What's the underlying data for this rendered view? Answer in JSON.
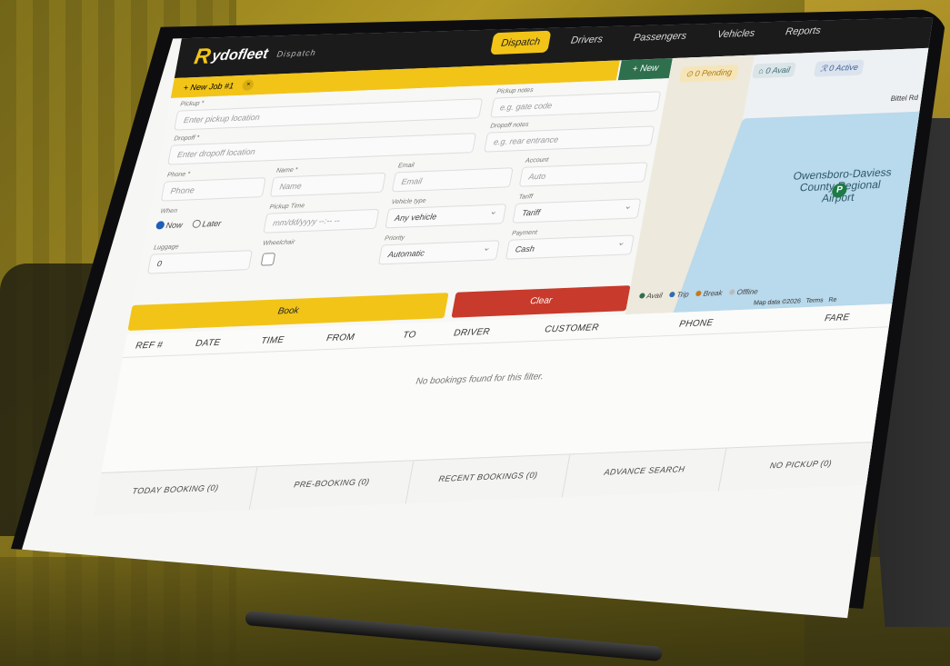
{
  "app": {
    "logo_mark": "R",
    "logo_text": "ydofleet",
    "logo_sub": "Dispatch"
  },
  "nav": [
    {
      "label": "Dispatch",
      "active": true
    },
    {
      "label": "Drivers",
      "active": false
    },
    {
      "label": "Passengers",
      "active": false
    },
    {
      "label": "Vehicles",
      "active": false
    },
    {
      "label": "Reports",
      "active": false
    }
  ],
  "job_tab": {
    "label": "+ New Job #1",
    "close": "×",
    "new_button": "+ New"
  },
  "form": {
    "pickup": {
      "label": "Pickup *",
      "placeholder": "Enter pickup location"
    },
    "pickup_notes": {
      "label": "Pickup notes",
      "placeholder": "e.g. gate code"
    },
    "dropoff": {
      "label": "Dropoff *",
      "placeholder": "Enter dropoff location"
    },
    "dropoff_notes": {
      "label": "Dropoff notes",
      "placeholder": "e.g. rear entrance"
    },
    "phone": {
      "label": "Phone *",
      "placeholder": "Phone"
    },
    "name": {
      "label": "Name *",
      "placeholder": "Name"
    },
    "email": {
      "label": "Email",
      "placeholder": "Email"
    },
    "account": {
      "label": "Account",
      "placeholder": "Auto"
    },
    "when": {
      "label": "When",
      "now": "Now",
      "later": "Later",
      "selected": "Now"
    },
    "pickup_time": {
      "label": "Pickup Time",
      "placeholder": "mm/dd/yyyy --:-- --"
    },
    "vehicle_type": {
      "label": "Vehicle type",
      "value": "Any vehicle"
    },
    "tariff": {
      "label": "Tariff",
      "value": "Tariff"
    },
    "luggage": {
      "label": "Luggage",
      "value": "0"
    },
    "wheelchair": {
      "label": "Wheelchair"
    },
    "priority": {
      "label": "Priority",
      "value": "Automatic"
    },
    "payment": {
      "label": "Payment",
      "value": "Cash"
    },
    "book_label": "Book",
    "clear_label": "Clear"
  },
  "map": {
    "pending": "⊙ 0 Pending",
    "avail": "⌂ 0 Avail",
    "active": "ℛ 0 Active",
    "road_label": "Bittel Rd",
    "airport_line1": "Owensboro-Daviess",
    "airport_line2": "County Regional",
    "airport_line3": "Airport",
    "pin_label": "P",
    "legend": [
      {
        "label": "Avail",
        "color": "#2e6f4e"
      },
      {
        "label": "Trip",
        "color": "#2f6db3"
      },
      {
        "label": "Break",
        "color": "#c77a1a"
      },
      {
        "label": "Offline",
        "color": "#bbbbbb"
      }
    ],
    "attribution": "Map data ©2026",
    "terms": "Terms",
    "report": "Re"
  },
  "table": {
    "headers": [
      "REF #",
      "DATE",
      "TIME",
      "FROM",
      "TO",
      "DRIVER",
      "CUSTOMER",
      "PHONE",
      "FARE"
    ],
    "empty_message": "No bookings found for this filter."
  },
  "bottom_tabs": [
    "TODAY BOOKING (0)",
    "PRE-BOOKING (0)",
    "RECENT BOOKINGS (0)",
    "ADVANCE SEARCH",
    "NO PICKUP (0)"
  ],
  "colors": {
    "accent": "#f2c418",
    "danger": "#c83a2b",
    "topbar": "#1b1b1b",
    "new": "#2e6f4e"
  }
}
